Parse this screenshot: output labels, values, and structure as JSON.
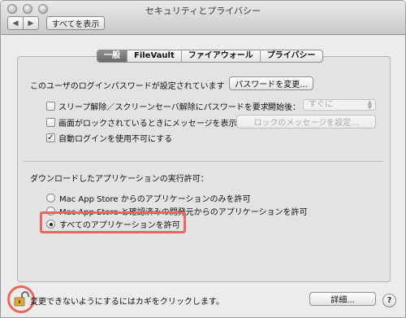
{
  "window": {
    "title": "セキュリティとプライバシー",
    "back_label": "◀",
    "forward_label": "▶",
    "show_all_label": "すべてを表示"
  },
  "tabs": [
    {
      "label": "一般",
      "active": true
    },
    {
      "label": "FileVault",
      "active": false
    },
    {
      "label": "ファイアウォール",
      "active": false
    },
    {
      "label": "プライバシー",
      "active": false
    }
  ],
  "general": {
    "password_text": "このユーザのログインパスワードが設定されています",
    "change_password_label": "パスワードを変更...",
    "require_password_label": "スリープ解除／スクリーンセーバ解除にパスワードを要求",
    "require_password_checked": false,
    "start_label": "開始後：",
    "start_value": "すぐに",
    "lock_message_label": "画面がロックされているときにメッセージを表示",
    "lock_message_checked": false,
    "set_lock_message_label": "ロックのメッセージを設定...",
    "disable_autologin_label": "自動ログインを使用不可にする",
    "disable_autologin_checked": true
  },
  "download": {
    "heading": "ダウンロードしたアプリケーションの実行許可：",
    "options": [
      {
        "label": "Mac App Store からのアプリケーションのみを許可",
        "selected": false
      },
      {
        "label": "Mac App Store と確認済みの開発元からのアプリケーションを許可",
        "selected": false
      },
      {
        "label": "すべてのアプリケーションを許可",
        "selected": true
      }
    ]
  },
  "footer": {
    "lock_text": "変更できないようにするにはカギをクリックします。",
    "advanced_label": "詳細...",
    "help_label": "?"
  },
  "colors": {
    "highlight": "#e8685d",
    "lock_gold": "#d9a640"
  },
  "icons": {
    "lock": "unlocked-padlock-icon",
    "help": "question-mark-icon"
  }
}
